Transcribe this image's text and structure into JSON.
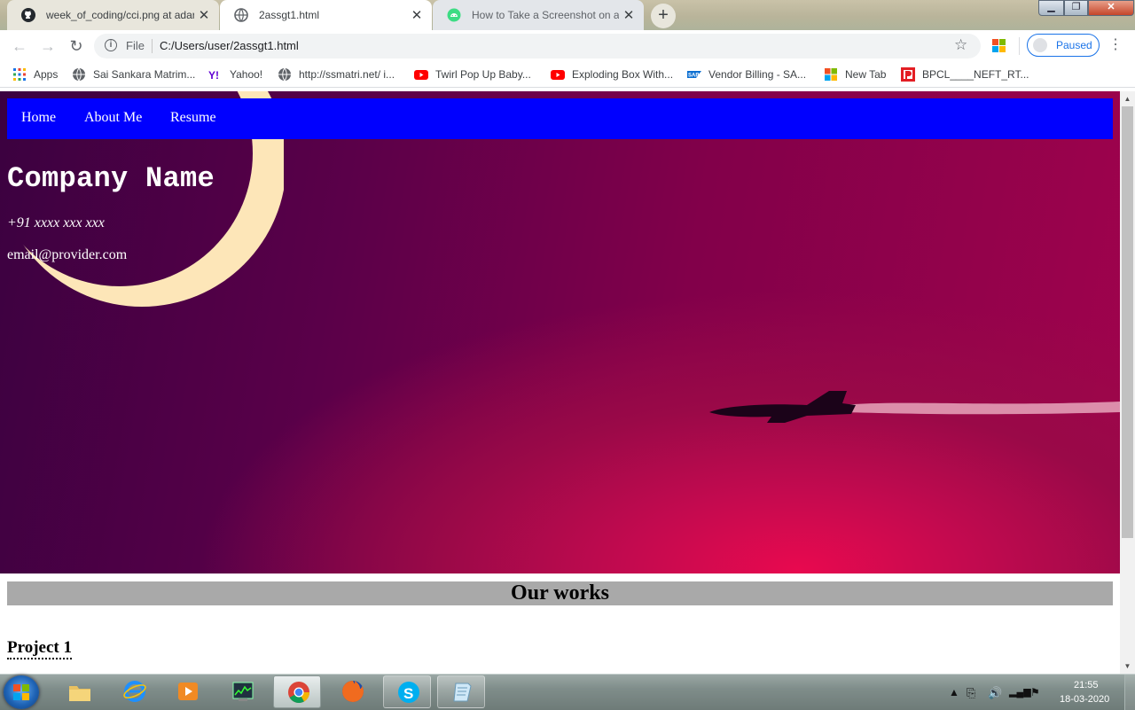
{
  "tabs": [
    {
      "title": "week_of_coding/cci.png at adarsh",
      "close": "✕",
      "favicon": "github-icon"
    },
    {
      "title": "2assgt1.html",
      "close": "✕",
      "favicon": "globe-icon"
    },
    {
      "title": "How to Take a Screenshot on a C",
      "close": "✕",
      "favicon": "android-icon"
    }
  ],
  "new_tab": "+",
  "window_controls": {
    "minimize": "▁",
    "maximize": "❐",
    "close": "✕"
  },
  "toolbar": {
    "back": "←",
    "forward": "→",
    "reload": "↻",
    "scheme": "File",
    "url": "C:/Users/user/2assgt1.html",
    "star": "☆",
    "profile_label": "Paused",
    "menu": "⋮"
  },
  "bookmarks": [
    {
      "label": "Apps",
      "icon": "apps-grid-icon"
    },
    {
      "label": "Sai Sankara Matrim...",
      "icon": "globe-icon"
    },
    {
      "label": "Yahoo!",
      "icon": "yahoo-icon"
    },
    {
      "label": "http://ssmatri.net/ i...",
      "icon": "globe-icon"
    },
    {
      "label": "Twirl Pop Up Baby...",
      "icon": "youtube-icon"
    },
    {
      "label": "Exploding Box With...",
      "icon": "youtube-icon"
    },
    {
      "label": "Vendor Billing - SA...",
      "icon": "sap-icon"
    },
    {
      "label": "New Tab",
      "icon": "windows-tile-icon"
    },
    {
      "label": "BPCL____NEFT_RT...",
      "icon": "bpcl-icon"
    }
  ],
  "page": {
    "nav": [
      "Home",
      "About Me",
      "Resume"
    ],
    "company_name": "Company Name",
    "phone": "+91 xxxx xxx xxx",
    "email": "email@provider.com",
    "works_heading": "Our works",
    "project_title": "Project 1"
  },
  "scrollbar": {
    "up": "▲",
    "down": "▼"
  },
  "taskbar": {
    "apps": [
      "windows-explorer",
      "internet-explorer",
      "media-player",
      "task-manager",
      "chrome",
      "firefox",
      "skype",
      "notepad"
    ],
    "active_app": "chrome",
    "time": "21:55",
    "date": "18-03-2020"
  },
  "colors": {
    "nav_bar": "#0000ff",
    "works_heading_bg": "#a9a9a9",
    "profile_accent": "#1a73e8"
  }
}
